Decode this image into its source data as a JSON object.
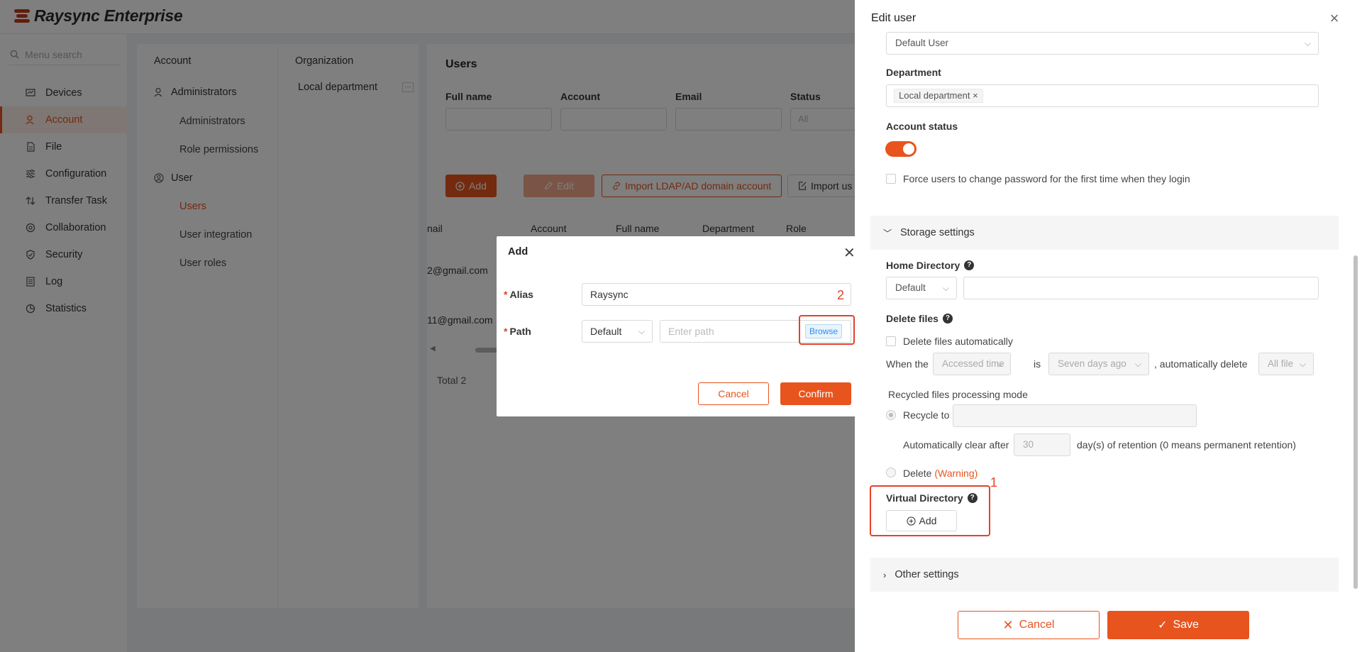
{
  "app": {
    "title": "Raysync Enterprise"
  },
  "sidebar": {
    "search_placeholder": "Menu search",
    "items": [
      {
        "label": "Devices",
        "icon": "devices-icon"
      },
      {
        "label": "Account",
        "icon": "account-icon",
        "active": true
      },
      {
        "label": "File",
        "icon": "file-icon"
      },
      {
        "label": "Configuration",
        "icon": "configuration-icon"
      },
      {
        "label": "Transfer Task",
        "icon": "transfer-icon"
      },
      {
        "label": "Collaboration",
        "icon": "collaboration-icon"
      },
      {
        "label": "Security",
        "icon": "shield-icon"
      },
      {
        "label": "Log",
        "icon": "log-icon"
      },
      {
        "label": "Statistics",
        "icon": "statistics-icon"
      }
    ]
  },
  "account_panel": {
    "header": "Account",
    "groups": [
      {
        "label": "Administrators",
        "children": [
          "Administrators",
          "Role permissions"
        ]
      },
      {
        "label": "User",
        "children": [
          "Users",
          "User integration",
          "User roles"
        ]
      }
    ]
  },
  "organization_panel": {
    "header": "Organization",
    "items": [
      "Local department"
    ]
  },
  "users_panel": {
    "title": "Users",
    "filters": {
      "full_name": "Full name",
      "account": "Account",
      "email": "Email",
      "status": "Status",
      "status_value": "All"
    },
    "toolbar": {
      "add": "Add",
      "edit": "Edit",
      "import_ldap": "Import LDAP/AD domain account",
      "import_users": "Import us"
    },
    "table": {
      "columns": [
        "nail",
        "Account",
        "Full name",
        "Department",
        "Role"
      ],
      "rows": [
        {
          "email": "2@gmail.com"
        },
        {
          "email": "11@gmail.com"
        }
      ]
    },
    "total": "Total 2"
  },
  "drawer": {
    "title": "Edit user",
    "role_value": "Default User",
    "department_label": "Department",
    "department_tag": "Local department",
    "account_status_label": "Account status",
    "account_status_on": true,
    "force_password_label": "Force users to change password for the first time when they login",
    "storage_settings": "Storage settings",
    "home_directory": {
      "label": "Home Directory",
      "select_value": "Default"
    },
    "delete_files": {
      "label": "Delete files",
      "auto_label": "Delete files automatically",
      "when_the": "When the",
      "accessed_time": "Accessed time",
      "is": "is",
      "seven_days_ago": "Seven days ago",
      "automatically_delete": ", automatically delete",
      "all_file": "All file"
    },
    "recycled": {
      "mode_label": "Recycled files processing mode",
      "recycle_to": "Recycle to",
      "auto_clear_after": "Automatically clear after",
      "days_value": "30",
      "retention_note": "day(s) of retention (0 means permanent retention)",
      "delete_label": "Delete",
      "warning": "(Warning)"
    },
    "virtual_directory": {
      "label": "Virtual Directory",
      "add": "Add"
    },
    "other_settings": "Other settings",
    "cancel": "Cancel",
    "save": "Save"
  },
  "annotations": {
    "one": "1",
    "two": "2"
  },
  "dialog": {
    "title": "Add",
    "alias_label": "Alias",
    "alias_value": "Raysync",
    "path_label": "Path",
    "path_select": "Default",
    "path_placeholder": "Enter path",
    "browse": "Browse",
    "cancel": "Cancel",
    "confirm": "Confirm"
  },
  "colors": {
    "accent": "#e8541e",
    "annotation": "#e4412a",
    "browse_blue": "#2d8cf0"
  }
}
